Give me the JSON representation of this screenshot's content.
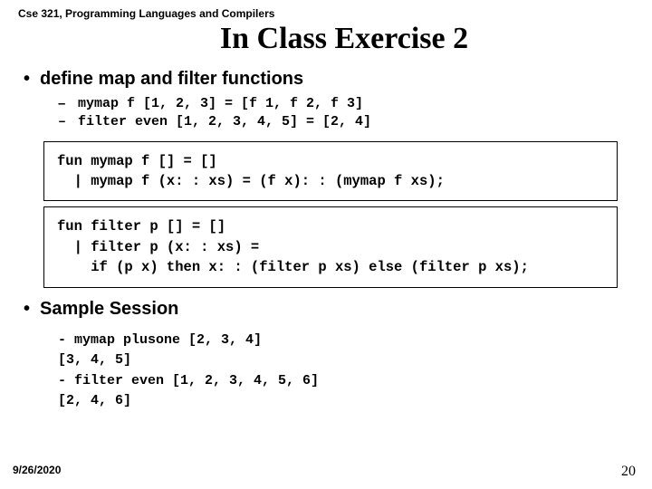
{
  "header": {
    "course": "Cse 321, Programming Languages and Compilers"
  },
  "title": "In Class Exercise 2",
  "section1": {
    "heading": "define map and filter  functions",
    "examples": [
      "mymap f  [1, 2, 3]   =   [f 1, f 2, f 3]",
      "filter even [1, 2, 3, 4, 5]   =   [2, 4]"
    ]
  },
  "code": {
    "mymap": "fun mymap f [] = []\n  | mymap f (x: : xs) = (f x): : (mymap f xs);",
    "filter": "fun filter p [] = []\n  | filter p (x: : xs) =\n    if (p x) then x: : (filter p xs) else (filter p xs);"
  },
  "section2": {
    "heading": "Sample Session",
    "lines": [
      "- mymap plusone [2, 3, 4]",
      "[3, 4, 5]",
      "- filter even [1, 2, 3, 4, 5, 6]",
      "[2, 4, 6]"
    ]
  },
  "footer": {
    "date": "9/26/2020",
    "page": "20"
  }
}
